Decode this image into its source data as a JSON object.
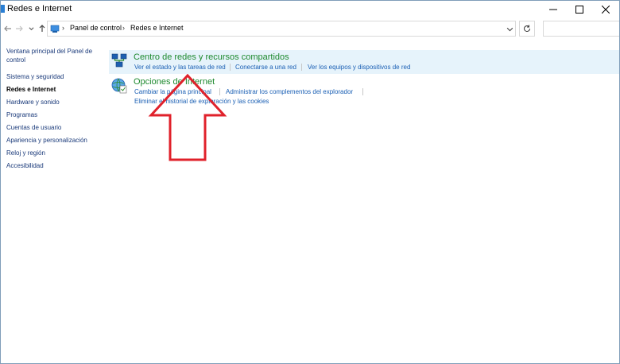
{
  "window": {
    "title": "Redes e Internet"
  },
  "address_bar": {
    "crumbs": [
      "Panel de control",
      "Redes e Internet"
    ],
    "search_placeholder": ""
  },
  "sidebar": {
    "items": [
      {
        "label": "Ventana principal del Panel de control",
        "bold": false
      },
      {
        "label": "Sistema y seguridad",
        "bold": false
      },
      {
        "label": "Redes e Internet",
        "bold": true
      },
      {
        "label": "Hardware y sonido",
        "bold": false
      },
      {
        "label": "Programas",
        "bold": false
      },
      {
        "label": "Cuentas de usuario",
        "bold": false
      },
      {
        "label": "Apariencia y personalización",
        "bold": false
      },
      {
        "label": "Reloj y región",
        "bold": false
      },
      {
        "label": "Accesibilidad",
        "bold": false
      }
    ]
  },
  "categories": [
    {
      "title": "Centro de redes y recursos compartidos",
      "links": [
        "Ver el estado y las tareas de red",
        "Conectarse a una red",
        "Ver los equipos y dispositivos de red"
      ],
      "icon": "network-icon"
    },
    {
      "title": "Opciones de Internet",
      "links": [
        "Cambiar la página principal",
        "Administrar los complementos del explorador",
        "Eliminar el historial de exploración y las cookies"
      ],
      "icon": "internet-options-icon"
    }
  ],
  "annotation": {
    "icon": "red-up-arrow",
    "color": "#e0212b"
  },
  "colors": {
    "category_title": "#1f8a2f",
    "link": "#1a5fb4",
    "highlight": "#e6f3fb"
  }
}
